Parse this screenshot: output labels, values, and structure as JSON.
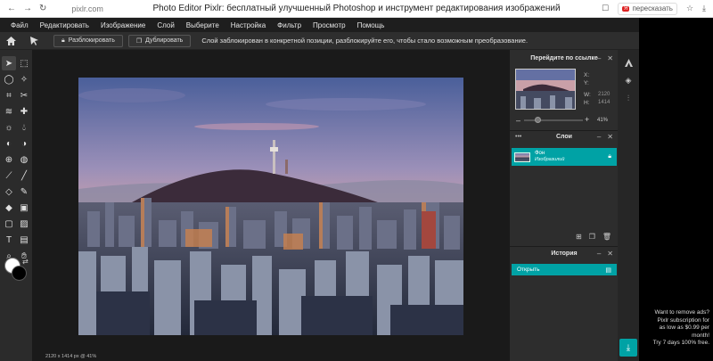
{
  "browser": {
    "url": "pixlr.com",
    "page_title": "Photo Editor Pixlr: бесплатный улучшенный Photoshop и инструмент редактирования изображений",
    "translate_label": "пересказать",
    "translate_badge": "Я"
  },
  "menu": [
    "Файл",
    "Редактировать",
    "Изображение",
    "Слой",
    "Выберите",
    "Настройка",
    "Фильтр",
    "Просмотр",
    "Помощь"
  ],
  "options_bar": {
    "unlock_label": "Разблокировать",
    "duplicate_label": "Дублировать",
    "hint": "Слой заблокирован в конкретной позиции, разблокируйте его, чтобы стало возможным преобразование."
  },
  "navigator": {
    "title": "Перейдите по ссылке",
    "x_label": "X:",
    "y_label": "Y:",
    "w_label": "W:",
    "h_label": "H:",
    "w_value": "2120",
    "h_value": "1414",
    "zoom": "41%",
    "zoom_fraction": 0.22
  },
  "layers": {
    "title": "Слои",
    "more": "•••",
    "items": [
      {
        "name": "Фон",
        "sub": "Изобразилий"
      }
    ]
  },
  "history": {
    "title": "История",
    "items": [
      "Открыть"
    ]
  },
  "status": "2120 x 1414 px @ 41%",
  "ad": {
    "lines": [
      "Want to remove ads?",
      "Pixlr subscription for",
      "as low as $0.99 per",
      "month!",
      "Try 7 days 100% free."
    ]
  },
  "colors": {
    "accent": "#00a2a5",
    "menubar": "#1e1e1e",
    "panel": "#2d2d2d",
    "workspace": "#1a1a1a"
  }
}
